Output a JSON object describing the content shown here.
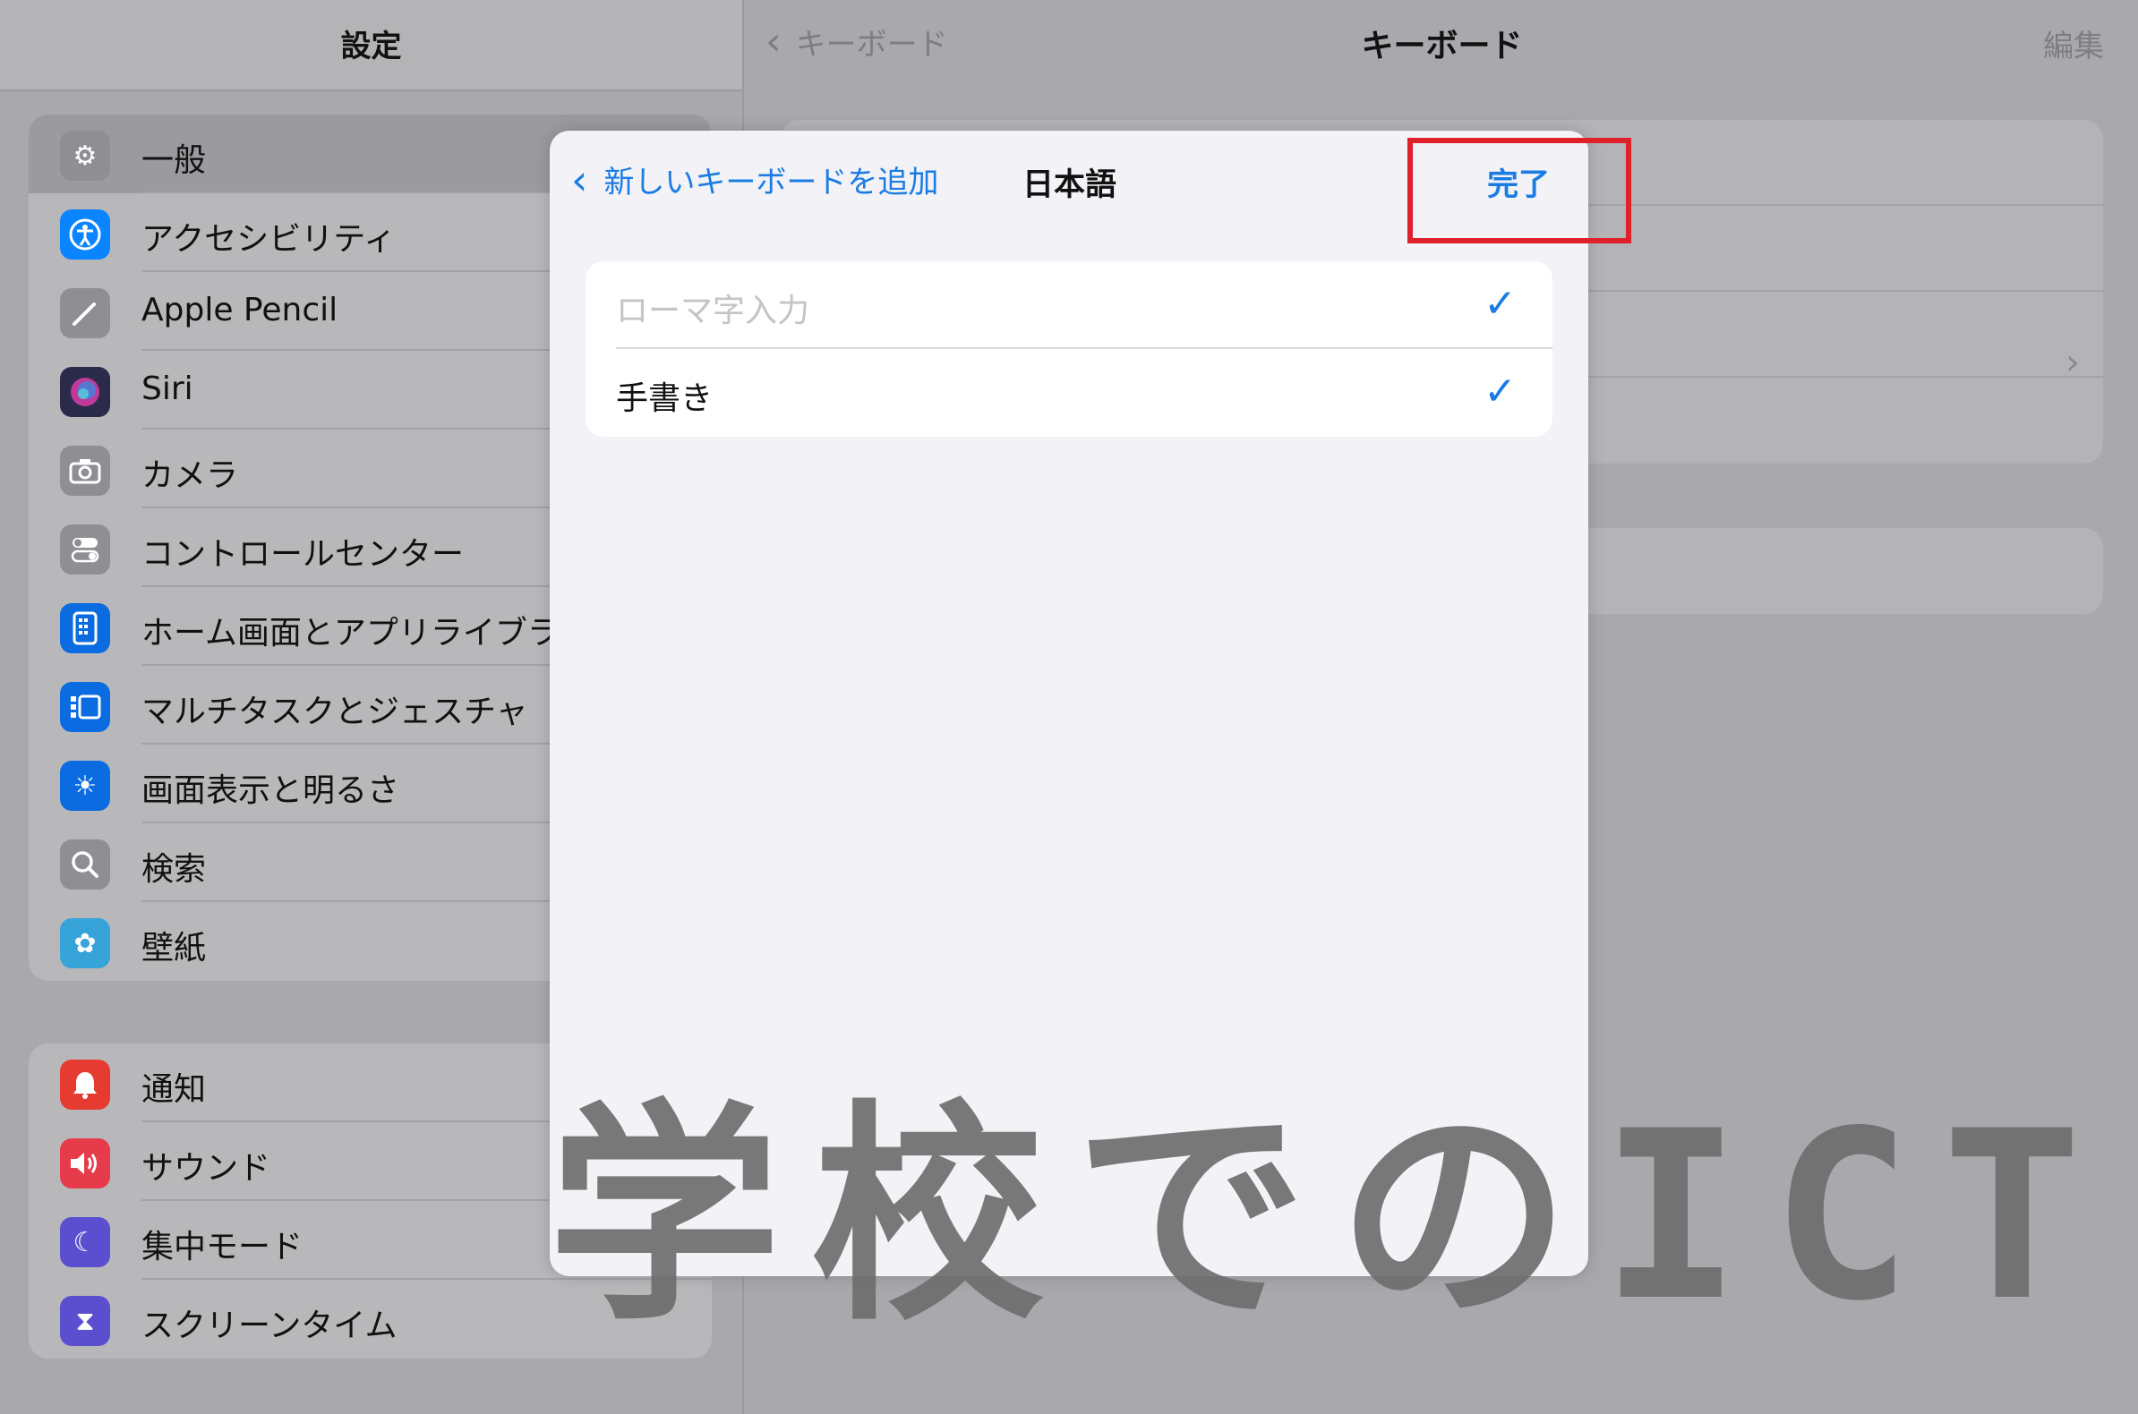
{
  "sidebar": {
    "title": "設定",
    "group1": [
      {
        "label": "一般",
        "icon": "gear-icon",
        "color": "#8e8e93",
        "selected": true
      },
      {
        "label": "アクセシビリティ",
        "icon": "accessibility-icon",
        "color": "#0a84ff"
      },
      {
        "label": "Apple Pencil",
        "icon": "pencil-icon",
        "color": "#8e8e93"
      },
      {
        "label": "Siri",
        "icon": "siri-icon",
        "color": "#3a3a6a"
      },
      {
        "label": "カメラ",
        "icon": "camera-icon",
        "color": "#8e8e93"
      },
      {
        "label": "コントロールセンター",
        "icon": "switches-icon",
        "color": "#8e8e93"
      },
      {
        "label": "ホーム画面とアプリライブラ",
        "icon": "home-screen-icon",
        "color": "#0a6ce0"
      },
      {
        "label": "マルチタスクとジェスチャ",
        "icon": "multitask-icon",
        "color": "#0a6ce0"
      },
      {
        "label": "画面表示と明るさ",
        "icon": "sun-icon",
        "color": "#0a6ce0"
      },
      {
        "label": "検索",
        "icon": "magnifier-icon",
        "color": "#8e8e93"
      },
      {
        "label": "壁紙",
        "icon": "flower-icon",
        "color": "#36a3d9"
      }
    ],
    "group2": [
      {
        "label": "通知",
        "icon": "bell-icon",
        "color": "#e63b30"
      },
      {
        "label": "サウンド",
        "icon": "speaker-icon",
        "color": "#e63b4a"
      },
      {
        "label": "集中モード",
        "icon": "moon-icon",
        "color": "#5b4fd0"
      },
      {
        "label": "スクリーンタイム",
        "icon": "hourglass-icon",
        "color": "#5b4fd0"
      }
    ]
  },
  "detail": {
    "back_label": "キーボード",
    "title": "キーボード",
    "edit_label": "編集"
  },
  "modal": {
    "back_label": "新しいキーボードを追加",
    "title": "日本語",
    "done_label": "完了",
    "options": [
      {
        "label": "ローマ字入力",
        "checked": true,
        "dimmed": true
      },
      {
        "label": "手書き",
        "checked": true,
        "dimmed": false
      }
    ]
  },
  "watermark": "学校でのICT",
  "colors": {
    "accent": "#1a7ce3",
    "highlight": "#e0202a"
  }
}
